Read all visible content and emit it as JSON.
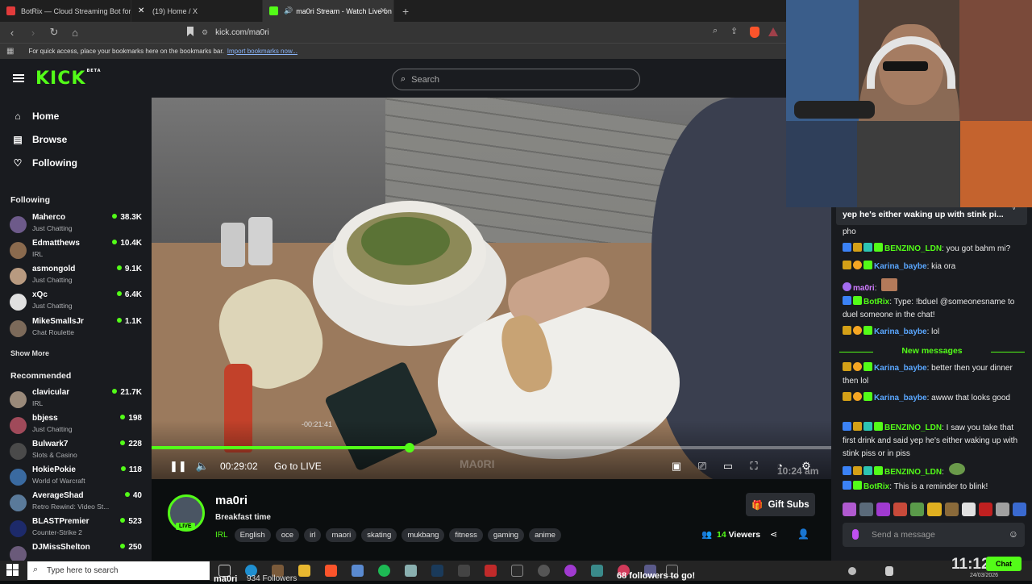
{
  "browser": {
    "tabs": [
      {
        "title": "BotRix — Cloud Streaming Bot for Tw",
        "active": false
      },
      {
        "title": "(19) Home / X",
        "active": false
      },
      {
        "title": "ma0ri Stream - Watch Live on",
        "active": true
      }
    ],
    "url": "kick.com/ma0ri",
    "bookmarks_hint": "For quick access, place your bookmarks here on the bookmarks bar.",
    "import_link": "Import bookmarks now..."
  },
  "kick": {
    "logo": "KICK",
    "logo_sup": "BETA",
    "search_placeholder": "Search",
    "accent": "#53fc18"
  },
  "sidebar": {
    "nav": [
      {
        "label": "Home",
        "icon": "home-icon"
      },
      {
        "label": "Browse",
        "icon": "browse-icon"
      },
      {
        "label": "Following",
        "icon": "heart-icon"
      }
    ],
    "following_title": "Following",
    "following": [
      {
        "name": "Maherco",
        "category": "Just Chatting",
        "viewers": "38.3K"
      },
      {
        "name": "Edmatthews",
        "category": "IRL",
        "viewers": "10.4K"
      },
      {
        "name": "asmongold",
        "category": "Just Chatting",
        "viewers": "9.1K"
      },
      {
        "name": "xQc",
        "category": "Just Chatting",
        "viewers": "6.4K"
      },
      {
        "name": "MikeSmallsJr",
        "category": "Chat Roulette",
        "viewers": "1.1K"
      }
    ],
    "show_more": "Show More",
    "recommended_title": "Recommended",
    "recommended": [
      {
        "name": "clavicular",
        "category": "IRL",
        "viewers": "21.7K"
      },
      {
        "name": "bbjess",
        "category": "Just Chatting",
        "viewers": "198"
      },
      {
        "name": "Bulwark7",
        "category": "Slots & Casino",
        "viewers": "228"
      },
      {
        "name": "HokiePokie",
        "category": "World of Warcraft",
        "viewers": "118"
      },
      {
        "name": "AverageShad",
        "category": "Retro Rewind: Video St...",
        "viewers": "40"
      },
      {
        "name": "BLASTPremier",
        "category": "Counter-Strike 2",
        "viewers": "523"
      },
      {
        "name": "DJMissShelton",
        "category": "",
        "viewers": "250"
      }
    ]
  },
  "player": {
    "hover_time": "-00:21:41",
    "elapsed": "00:29:02",
    "go_live": "Go to LIVE",
    "progress": 0.38,
    "watermark": "MA0RI",
    "overlay_clock": "10:24 am"
  },
  "stream": {
    "channel": "ma0ri",
    "live": "LIVE",
    "title": "Breakfast time",
    "category": "IRL",
    "tags": [
      "English",
      "oce",
      "irl",
      "maori",
      "skating",
      "mukbang",
      "fitness",
      "gaming",
      "anime"
    ],
    "gift_subs": "Gift Subs",
    "viewer_count": "14",
    "viewer_label": "Viewers"
  },
  "chat": {
    "pinned": "yep he's either waking up with stink pi...",
    "top_fragment": "pho",
    "messages": [
      {
        "user": "BENZINO_LDN",
        "color": "green",
        "badges": [
          "blue",
          "gold",
          "teal",
          "green"
        ],
        "text": ": you got bahm mi?"
      },
      {
        "user": "Karina_baybe",
        "color": "blue",
        "badges": [
          "gold",
          "orange",
          "green"
        ],
        "text": ": kia ora"
      },
      {
        "user": "ma0ri",
        "color": "purple",
        "badges": [
          "purple"
        ],
        "text": ":"
      },
      {
        "user": "BotRix",
        "color": "green",
        "badges": [
          "blue",
          "green"
        ],
        "text": ": Type: !bduel @someonesname to duel someone in the chat!"
      },
      {
        "user": "Karina_baybe",
        "color": "blue",
        "badges": [
          "gold",
          "orange",
          "green"
        ],
        "text": ": lol"
      }
    ],
    "new_messages": "New messages",
    "new": [
      {
        "user": "Karina_baybe",
        "color": "blue",
        "badges": [
          "gold",
          "orange",
          "green"
        ],
        "text": ": better then your dinner then lol"
      },
      {
        "user": "Karina_baybe",
        "color": "blue",
        "badges": [
          "gold",
          "orange",
          "green"
        ],
        "text": ": awww that looks good"
      },
      {
        "user": "BENZINO_LDN",
        "color": "green",
        "badges": [
          "blue",
          "gold",
          "teal",
          "green"
        ],
        "text": ": I saw you take that first drink and said yep he's either waking up with stink piss or in piss"
      },
      {
        "user": "BENZINO_LDN",
        "color": "green",
        "badges": [
          "blue",
          "gold",
          "teal",
          "green"
        ],
        "text": ":"
      },
      {
        "user": "BotRix",
        "color": "green",
        "badges": [
          "blue",
          "green"
        ],
        "text": ": This is a reminder to blink!"
      }
    ],
    "input_placeholder": "Send a message",
    "send_label": "Chat"
  },
  "taskbar": {
    "search_placeholder": "Type here to search",
    "overlay_name": "ma0ri",
    "overlay_followers": "934 Followers",
    "overlay_goal": "68 followers to go!",
    "clock": "11:12 am",
    "date": "24/03/2026"
  }
}
